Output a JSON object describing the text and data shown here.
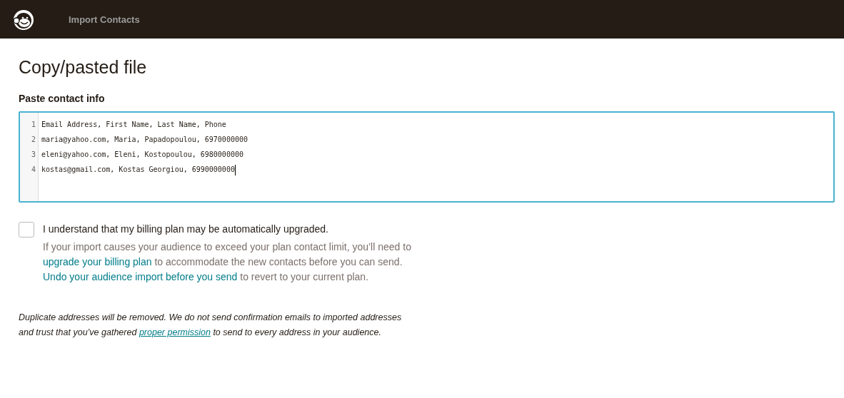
{
  "header": {
    "title": "Import Contacts"
  },
  "page": {
    "title": "Copy/pasted file"
  },
  "editor": {
    "label": "Paste contact info",
    "lines": [
      {
        "number": "1",
        "text": "Email Address, First Name, Last Name, Phone"
      },
      {
        "number": "2",
        "text": "maria@yahoo.com, Maria, Papadopoulou, 6970000000"
      },
      {
        "number": "3",
        "text": "eleni@yahoo.com, Eleni, Kostopoulou, 6980000000"
      },
      {
        "number": "4",
        "text": "kostas@gmail.com, Kostas Georgiou, 6990000000"
      }
    ]
  },
  "consent": {
    "label": "I understand that my billing plan may be automatically upgraded.",
    "checked": false,
    "help": [
      {
        "kind": "text",
        "text": "If your import causes your audience to exceed your plan contact limit, you’ll need to "
      },
      {
        "kind": "link",
        "text": "upgrade your billing plan"
      },
      {
        "kind": "text",
        "text": " to accommodate the new contacts before you can send. "
      },
      {
        "kind": "link",
        "text": "Undo your audience import before you send"
      },
      {
        "kind": "text",
        "text": " to revert to your current plan."
      }
    ]
  },
  "note": [
    {
      "kind": "text",
      "text": "Duplicate addresses will be removed. We do not send confirmation emails to imported addresses and trust that you’ve gathered "
    },
    {
      "kind": "link",
      "text": "proper permission"
    },
    {
      "kind": "text",
      "text": " to send to every address in your audience."
    }
  ]
}
